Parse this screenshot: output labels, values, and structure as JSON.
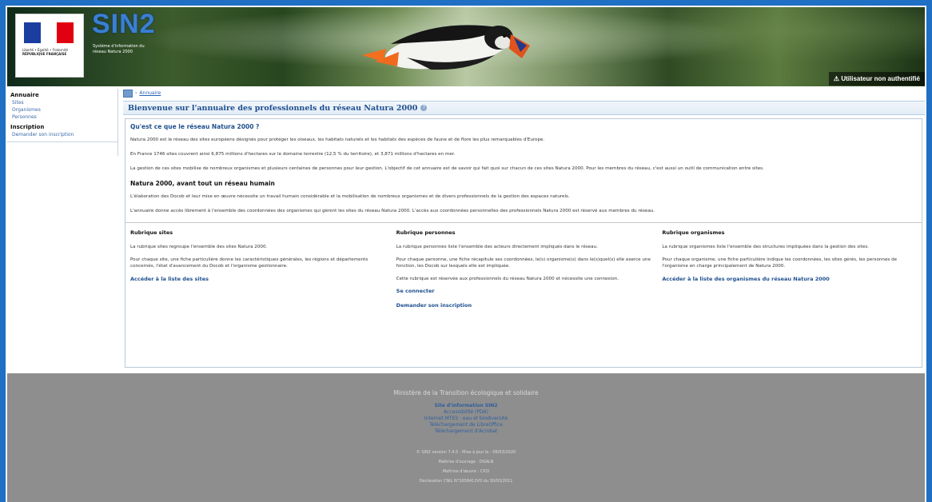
{
  "header": {
    "logo_lines": [
      "Liberté • Égalité • Fraternité",
      "RÉPUBLIQUE FRANÇAISE"
    ],
    "app_name": "SIN2",
    "subtitle": "Système d'information du réseau Natura 2000",
    "user_status": "Utilisateur non authentifié",
    "flag_colors": [
      "#1a3ea0",
      "#ffffff",
      "#e1000f"
    ]
  },
  "sidebar": {
    "sections": [
      {
        "title": "Annuaire",
        "items": [
          "Sites",
          "Organismes",
          "Personnes"
        ]
      },
      {
        "title": "Inscription",
        "items": [
          "Demander son inscription"
        ]
      }
    ]
  },
  "breadcrumb": {
    "label": "Annuaire"
  },
  "page_title": "Bienvenue sur l'annuaire des professionnels du réseau Natura 2000",
  "intro": {
    "heading": "Qu'est ce que le réseau Natura 2000 ?",
    "paragraphs": [
      "Natura 2000 est le réseau des sites européens désignés pour protéger les oiseaux, les habitats naturels et les habitats des espèces de faune et de flore les plus remarquables d'Europe.",
      "En France 1746 sites couvrent ainsi 6,875 millions d'hectares sur le domaine terrestre (12,5 % du territoire), et 3,871 millions d'hectares en mer.",
      "La gestion de ces sites mobilise de nombreux organismes et plusieurs centaines de personnes pour leur gestion. L'objectif de cet annuaire est de savoir qui fait quoi sur chacun de ces sites Natura 2000. Pour les membres du réseau, c'est aussi un outil de communication entre sites."
    ]
  },
  "human": {
    "heading": "Natura 2000, avant tout un réseau humain",
    "paragraphs": [
      "L'élaboration des Docob et leur mise en œuvre nécessite un travail humain considérable et la mobilisation de nombreux organismes et de divers professionnels de la gestion des espaces naturels.",
      "L'annuaire donne accès librement à l'ensemble des coordonnées des organismes qui gèrent les sites du réseau Natura 2000. L'accès aux coordonnées personnelles des professionnels Natura 2000 est réservé aux membres du réseau."
    ]
  },
  "columns": [
    {
      "heading": "Rubrique sites",
      "paragraphs": [
        "La rubrique sites regroupe l'ensemble des sites Natura 2000.",
        "Pour chaque site, une fiche particulière donne les caractéristiques générales, les régions et départements concernés, l'état d'avancement du Docob et l'organisme gestionnaire."
      ],
      "links": [
        "Accéder à la liste des sites"
      ]
    },
    {
      "heading": "Rubrique personnes",
      "paragraphs": [
        "La rubrique personnes liste l'ensemble des acteurs directement impliqués dans le réseau.",
        "Pour chaque personne, une fiche récapitule ses coordonnées, le(s) organisme(s) dans le(s)quel(s) elle exerce une fonction, les Docob sur lesquels elle est impliquée.",
        "Cette rubrique est réservée aux professionnels du réseau Natura 2000 et nécessite une connexion."
      ],
      "links": [
        "Se connecter",
        "Demander son inscription"
      ]
    },
    {
      "heading": "Rubrique organismes",
      "paragraphs": [
        "La rubrique organismes liste l'ensemble des structures impliquées dans la gestion des sites.",
        "Pour chaque organisme, une fiche particulière indique les coordonnées, les sites gérés, les personnes de l'organisme en charge principalement de Natura 2000."
      ],
      "links": [
        "Accéder à la liste des organismes du réseau Natura 2000"
      ]
    }
  ],
  "footer": {
    "ministry": "Ministère de la Transition écologique et solidaire",
    "links": [
      "Site d'information SIN2",
      "Accessibilité (PDA)",
      "Internet MTES : eau et biodiversité",
      "Téléchargement de LibreOffice",
      "Téléchargement d'Acrobat"
    ],
    "info": [
      "© SIN2 version 7.4.5 - Mise à jour le : 06/03/2020",
      "Maîtrise d'ouvrage : DGALN",
      "Maîtrise d'œuvre : CP2I",
      "Déclaration CNIL N°1658412V0 du 30/03/2011"
    ]
  }
}
